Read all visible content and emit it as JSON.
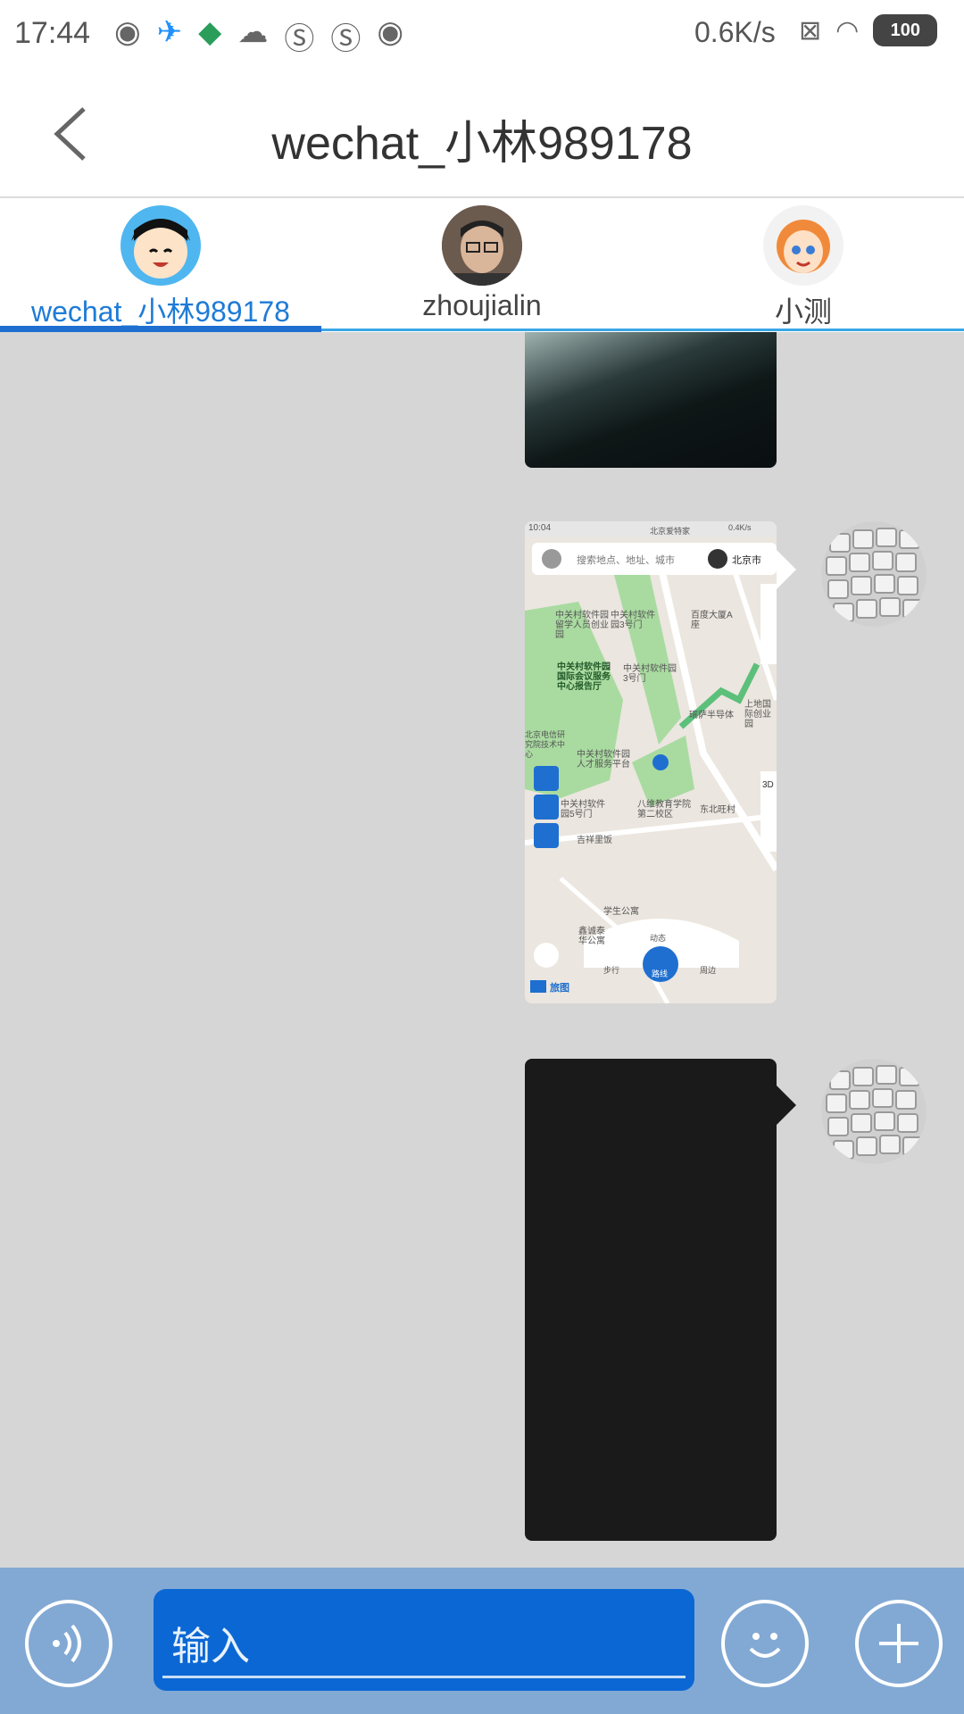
{
  "status_bar": {
    "time": "17:44",
    "net_speed": "0.6K/s",
    "battery": "100"
  },
  "header": {
    "title": "wechat_小林989178"
  },
  "tabs": [
    {
      "label": "wechat_小林989178"
    },
    {
      "label": "zhoujialin"
    },
    {
      "label": "小测"
    }
  ],
  "map_screenshot": {
    "status_time": "10:04",
    "status_speed": "0.4K/s",
    "status_place": "北京爱特家",
    "search_placeholder": "搜索地点、地址、城市",
    "city": "北京市",
    "pois": [
      "中关村软件园留学人员创业园",
      "中关村软件园3号门",
      "百度大厦A座",
      "中关村软件园国际会议服务中心报告厅",
      "中关村软件园3号门",
      "瑞萨半导体",
      "上地国际创业园",
      "中关村软件园人才服务平台",
      "中关村软件园5号门",
      "八维教育学院第二校区",
      "东北旺村",
      "吉祥里饭",
      "学生公寓",
      "鑫诚泰华公寓",
      "北京电信研究院技术中心"
    ],
    "nav": [
      "动态",
      "步行",
      "路线",
      "周边"
    ],
    "brand": "旅图",
    "zoom_3d": "3D"
  },
  "input": {
    "placeholder": "输入"
  },
  "colors": {
    "chat_bg": "#d6d6d6",
    "input_bar": "#82a9d4",
    "input_field": "#0b67d4",
    "active_tab": "#1e6fd0"
  }
}
